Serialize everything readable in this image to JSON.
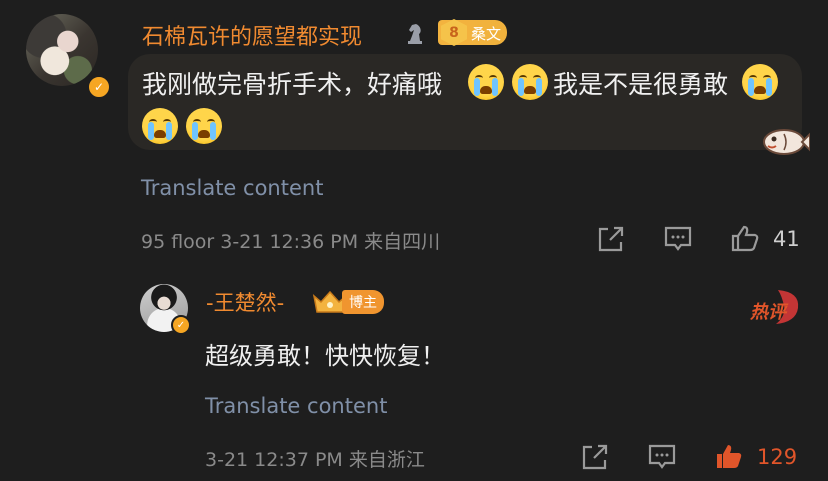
{
  "comment": {
    "username": "石棉瓦许的愿望都实现",
    "level_number": "8",
    "level_name": "桑文",
    "text_part1": "我刚做完骨折手术，好痛哦",
    "text_part2": "我是不是很勇敢",
    "emoji_name": "crying-face",
    "translate_label": "Translate content",
    "meta": "95 floor 3-21 12:36 PM 来自四川",
    "like_count": "41"
  },
  "reply": {
    "username": "-王楚然-",
    "badge_label": "博主",
    "text": "超级勇敢！快快恢复！",
    "translate_label": "Translate content",
    "meta": "3-21 12:37 PM 来自浙江",
    "like_count": "129",
    "hot_label": "热评"
  },
  "colors": {
    "background": "#1e1e1e",
    "username": "#f08a30",
    "translate_link": "#8090a8",
    "liked": "#e0552a",
    "bubble": "#2a2825"
  }
}
